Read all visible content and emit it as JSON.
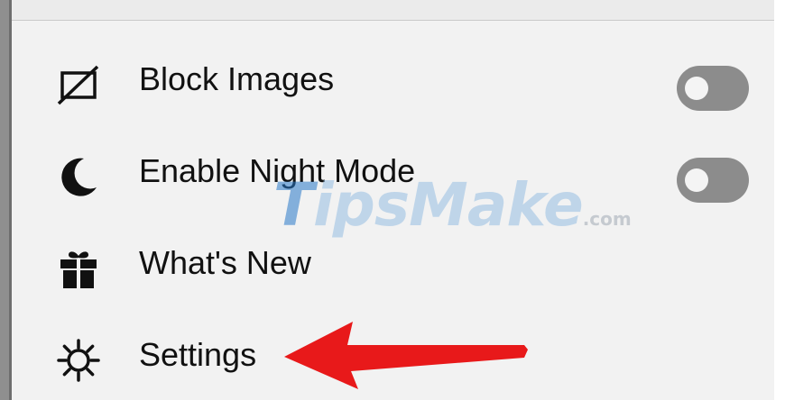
{
  "menu": {
    "items": [
      {
        "label": "Block Images",
        "icon": "block-images-icon",
        "toggle": "off"
      },
      {
        "label": "Enable Night Mode",
        "icon": "moon-icon",
        "toggle": "off"
      },
      {
        "label": "What's New",
        "icon": "gift-icon"
      },
      {
        "label": "Settings",
        "icon": "gear-icon"
      }
    ]
  },
  "watermark": {
    "main": "ipsMake",
    "first": "T",
    "suffix": ".com"
  },
  "annotation": {
    "arrow_color": "#e8191a",
    "points_to": "Settings"
  },
  "colors": {
    "panel": "#f2f2f2",
    "toggle_off": "#8c8c8c",
    "text": "#111111"
  }
}
